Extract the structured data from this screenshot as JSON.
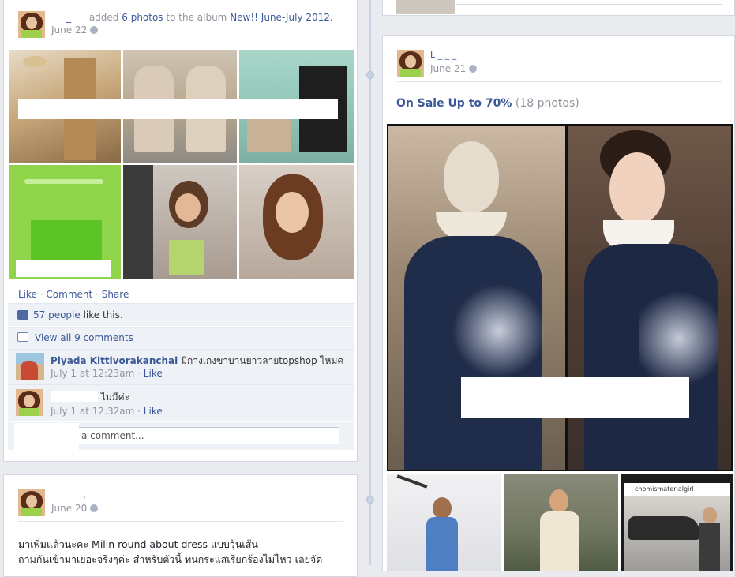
{
  "post1": {
    "author": "_",
    "action_prefix": "added",
    "count_text": "6 photos",
    "action_mid": "to the album",
    "album": "New!! June-July 2012.",
    "date": "June 22",
    "actions": {
      "like": "Like",
      "comment": "Comment",
      "share": "Share",
      "sep": "·"
    },
    "likes": {
      "link": "57 people",
      "text": "like this."
    },
    "view_comments": "View all 9 comments",
    "comments": [
      {
        "author": "Piyada Kittivorakanchai",
        "text": "มีกางเกงขาบานยาวลายtopshop ไหมคะ",
        "time": "July 1 at 12:23am",
        "like": "Like"
      },
      {
        "author": "",
        "text": "ไม่มีค่ะ",
        "time": "July 1 at 12:32am",
        "like": "Like"
      }
    ],
    "comment_placeholder": "a comment..."
  },
  "post2": {
    "author": "L _ _ _",
    "date": "June 21",
    "album_title": "On Sale Up to 70%",
    "album_count": "(18 photos)",
    "thumb_caption": "chomismaterialgirl"
  },
  "post3": {
    "author": "_ ,",
    "date": "June 20",
    "text_line1": "มาเพิ่มแล้วนะคะ Milin round about dress แบบวุ้นเส้น",
    "text_line2": "ถามกันเข้ามาเยอะจริงๆค่ะ สำหรับตัวนี้ ทนกระแสเรียกร้องไม่ไหว เลยจัด"
  },
  "colors": {
    "link": "#3b5998",
    "timeline": "#c9d2e4",
    "background": "#e9ebee"
  }
}
